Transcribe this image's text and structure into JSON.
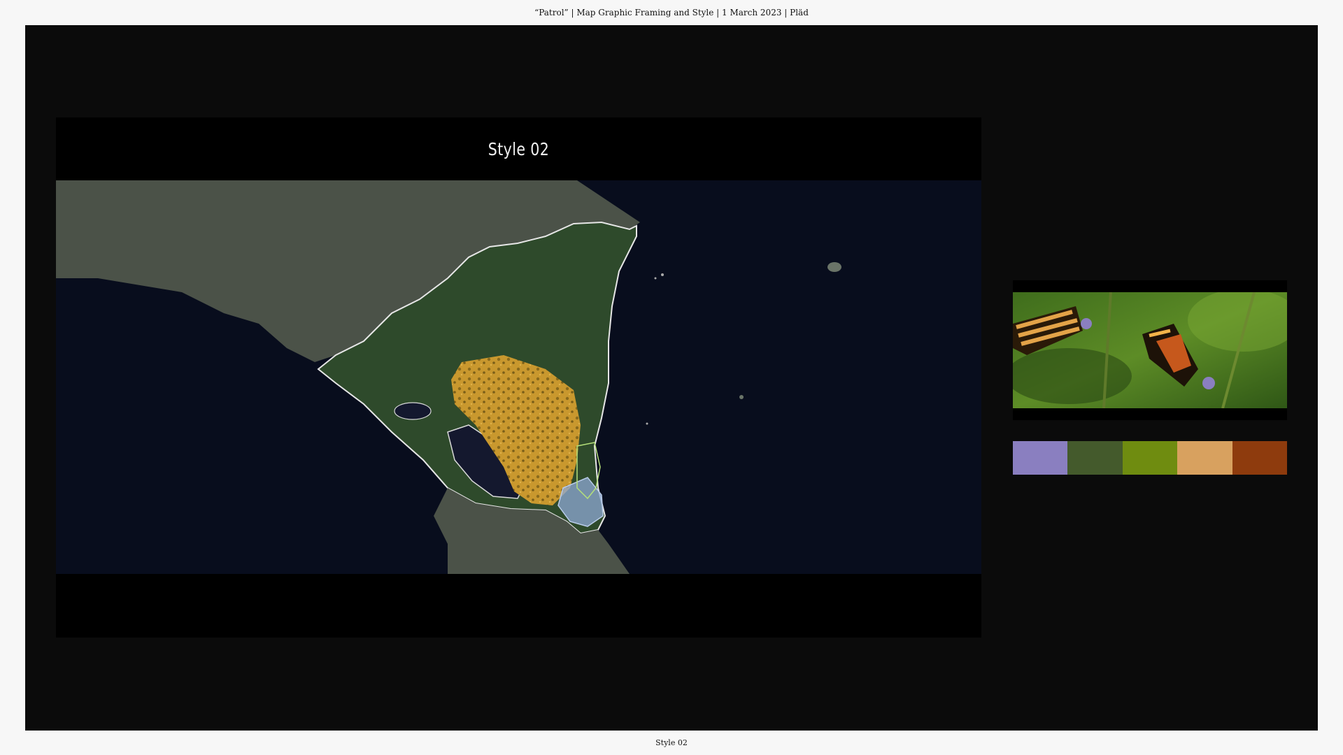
{
  "header": {
    "caption": "“Patrol” | Map Graphic Framing and Style | 1 March 2023 | Pläd"
  },
  "frame": {
    "title": "Style 02"
  },
  "map": {
    "ocean_color": "#080d1d",
    "land_color": "#4b5248",
    "country_color": "#2e4a2b",
    "highlight_color": "#c9982e",
    "protected_area_color": "#8fa9d6"
  },
  "photo": {
    "subject": "butterflies-on-stems"
  },
  "palette": {
    "swatches": [
      {
        "name": "lavender",
        "color": "#8a7fc0"
      },
      {
        "name": "forest-green",
        "color": "#445a2c"
      },
      {
        "name": "olive-green",
        "color": "#6f8c10"
      },
      {
        "name": "sand",
        "color": "#d8a15f"
      },
      {
        "name": "rust",
        "color": "#8e3b0d"
      }
    ]
  },
  "footer": {
    "caption": "Style 02"
  }
}
